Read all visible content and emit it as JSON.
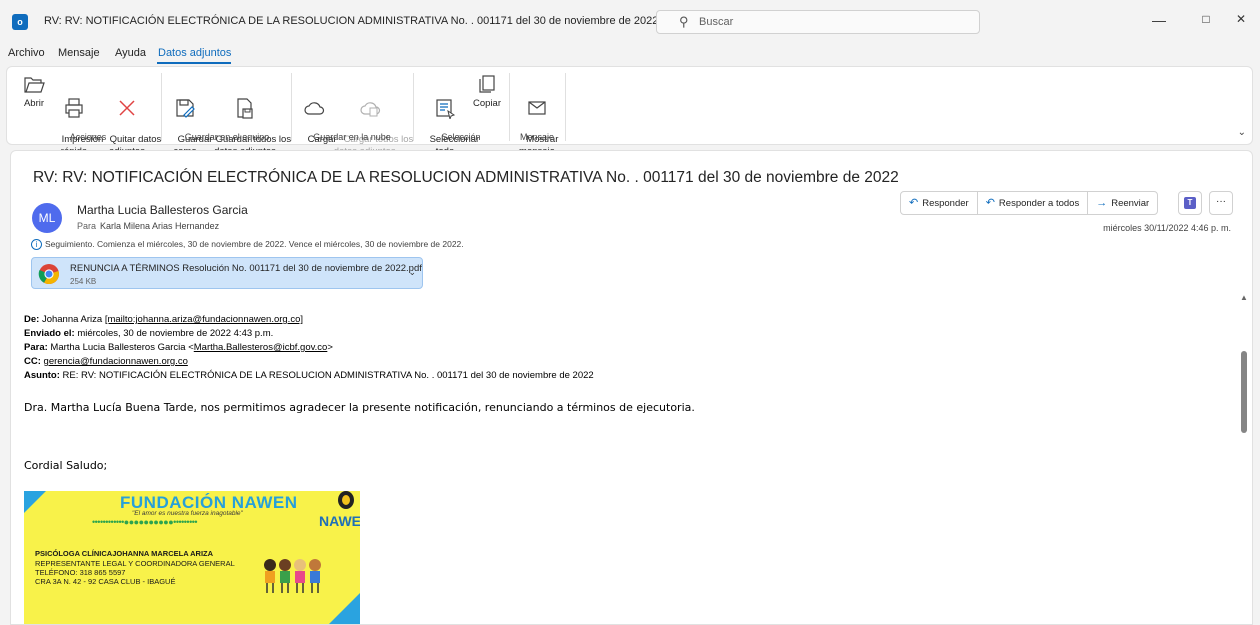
{
  "window": {
    "app_icon_letter": "o",
    "title": "RV: RV: NOTIFICACIÓN ELECTRÓNICA DE LA RESOLUCION ADMINISTRATIVA No. . 001171 del 30 de noviembre de 2022  -  Mensaje (HTML)",
    "search_placeholder": "Buscar",
    "minimize": "—",
    "restore": "□",
    "close": "✕"
  },
  "menu": [
    "Archivo",
    "Mensaje",
    "Ayuda",
    "Datos adjuntos"
  ],
  "ribbon": {
    "groups": [
      {
        "label": "Acciones",
        "buttons": [
          {
            "label": "Abrir"
          },
          {
            "label": "Impresión\nrápida"
          },
          {
            "label": "Quitar datos\nadjuntos"
          }
        ]
      },
      {
        "label": "Guardar en el equipo",
        "buttons": [
          {
            "label": "Guardar\ncomo"
          },
          {
            "label": "Guardar todos los\ndatos adjuntos"
          }
        ]
      },
      {
        "label": "Guardar en la nube",
        "buttons": [
          {
            "label": "Cargar\n⌄"
          },
          {
            "label": "Cargar todos los\ndatos adjuntos ⌄"
          }
        ]
      },
      {
        "label": "Selección",
        "buttons": [
          {
            "label": "Seleccionar\ntodo"
          },
          {
            "label": "Copiar"
          }
        ]
      },
      {
        "label": "Mensaje",
        "buttons": [
          {
            "label": "Mostrar\nmensaje"
          }
        ]
      }
    ]
  },
  "message": {
    "subject": "RV: RV: NOTIFICACIÓN ELECTRÓNICA DE LA RESOLUCION ADMINISTRATIVA No. . 001171 del 30 de noviembre de 2022",
    "avatar_initials": "ML",
    "sender": "Martha Lucia Ballesteros Garcia",
    "to_label": "Para",
    "to": "Karla Milena Arias Hernandez",
    "followup": "Seguimiento.  Comienza el miércoles, 30 de noviembre de 2022.  Vence el miércoles, 30 de noviembre de 2022.",
    "attachment": {
      "name": "RENUNCIA A TÉRMINOS Resolución No. 001171 del 30 de noviembre de 2022.pdf",
      "size": "254 KB"
    },
    "actions": {
      "reply": "Responder",
      "reply_all": "Responder a todos",
      "forward": "Reenviar"
    },
    "datetime": "miércoles 30/11/2022 4:46 p. m."
  },
  "body": {
    "de_label": "De:",
    "de_value": "Johanna Ariza ",
    "de_link": "[mailto:johanna.ariza@fundacionnawen.org.co]",
    "enviado_label": "Enviado el:",
    "enviado_value": " miércoles, 30 de noviembre de 2022 4:43 p.m.",
    "para_label": "Para:",
    "para_value": " Martha Lucia Ballesteros Garcia <",
    "para_link": "Martha.Ballesteros@icbf.gov.co",
    "para_end": ">",
    "cc_label": "CC:",
    "cc_link": "gerencia@fundacionnawen.org.co",
    "asunto_label": "Asunto:",
    "asunto_value": " RE: RV: NOTIFICACIÓN ELECTRÓNICA DE LA RESOLUCION ADMINISTRATIVA No. . 001171 del 30 de noviembre de 2022",
    "greeting": "Dra. Martha Lucía Buena Tarde, nos permitimos agradecer la presente notificación, renunciando a términos de ejecutoria.",
    "cordial": "Cordial Saludo;"
  },
  "signature": {
    "org": "FUNDACIÓN NAWEN",
    "slogan": "\"El amor es nuestra fuerza inagotable\"",
    "dots": "••••••••••••●●●●●●●●●●•••••••••",
    "brand": "NAWEN",
    "name": "PSICÓLOGA CLÍNICAJOHANNA MARCELA ARIZA",
    "role": "REPRESENTANTE LEGAL Y COORDINADORA GENERAL",
    "phone": "TELÉFONO: 318 865 5597",
    "address": "CRA 3A N. 42 - 92 CASA CLUB - IBAGUÉ"
  }
}
